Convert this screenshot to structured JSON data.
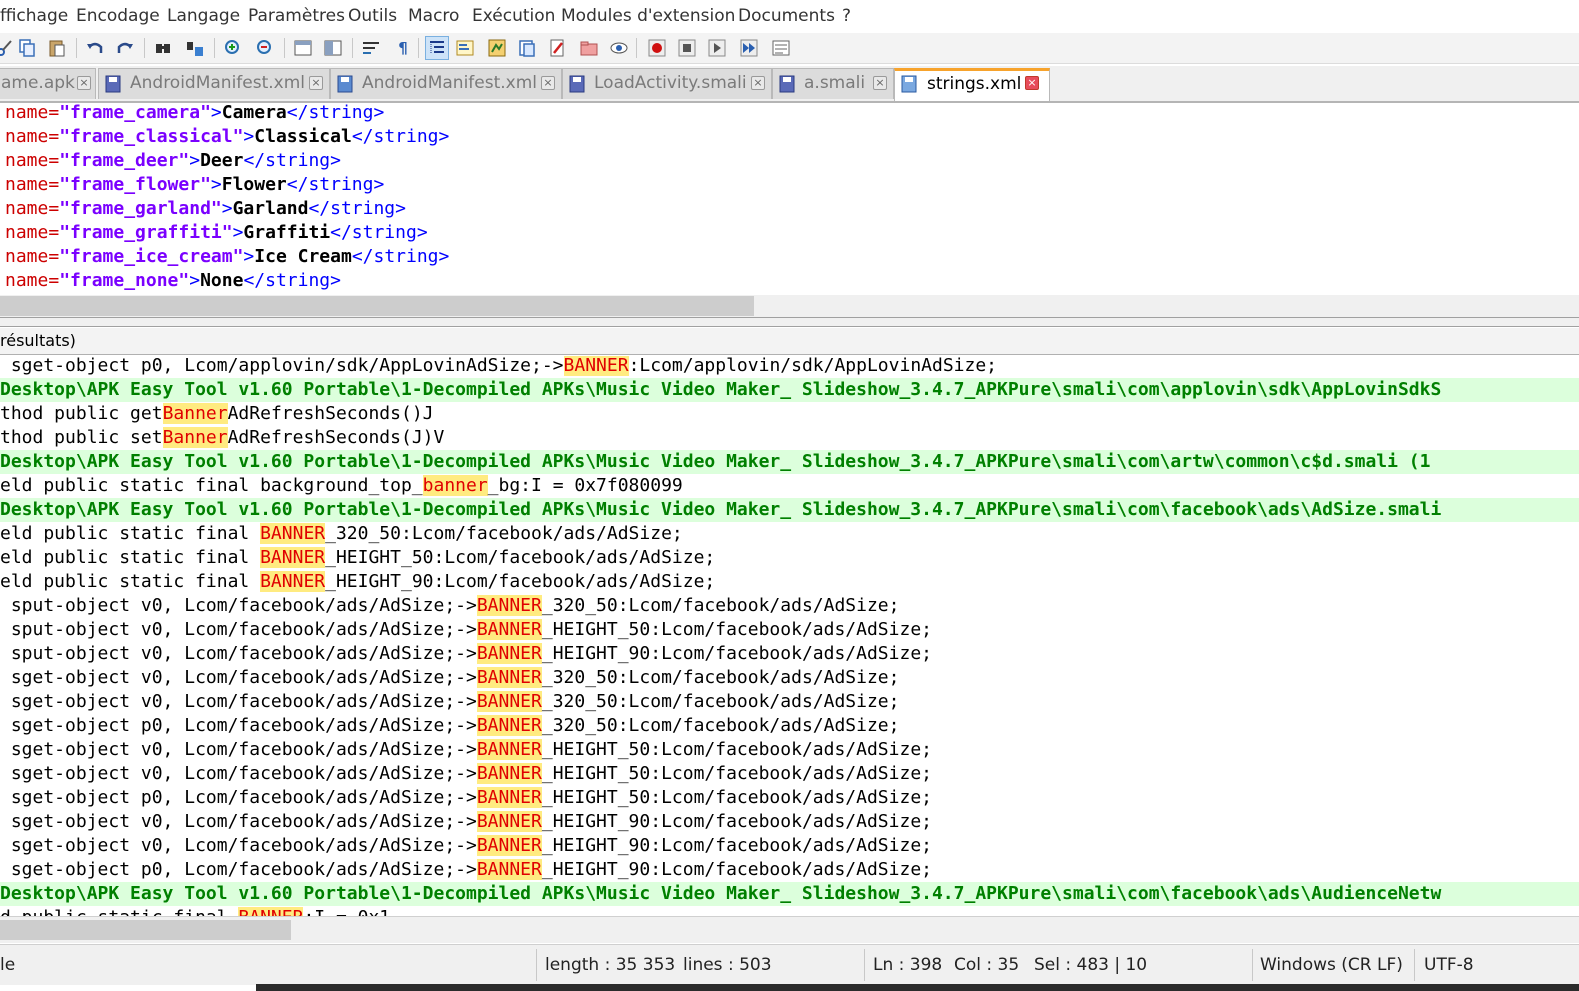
{
  "menu": [
    "ffichage",
    "Encodage",
    "Langage",
    "Paramètres",
    "Outils",
    "Macro",
    "Exécution",
    "Modules d'extension",
    "Documents",
    "?"
  ],
  "toolbar_icons": [
    "cut-icon",
    "copy-icon",
    "paste-icon",
    "undo-icon",
    "redo-icon",
    "find-icon",
    "replace-icon",
    "zoom-in-icon",
    "zoom-out-icon",
    "sync-vertical-icon",
    "sync-horizontal-icon",
    "word-wrap-icon",
    "show-all-chars-icon",
    "indent-guide-icon",
    "function-list-icon",
    "document-map-icon",
    "folder-workspace-icon",
    "monitoring-icon",
    "record-macro-icon",
    "stop-record-icon",
    "play-macro-icon",
    "run-macro-multiple-icon",
    "save-macro-icon"
  ],
  "tabs": [
    {
      "label": "ame.apk",
      "active": false
    },
    {
      "label": "AndroidManifest.xml",
      "active": false
    },
    {
      "label": "AndroidManifest.xml",
      "active": false
    },
    {
      "label": "LoadActivity.smali",
      "active": false
    },
    {
      "label": "a.smali",
      "active": false
    },
    {
      "label": "strings.xml",
      "active": true
    }
  ],
  "editor_lines": [
    {
      "attr": "name=",
      "val": "\"frame_camera\"",
      "text": "Camera"
    },
    {
      "attr": "name=",
      "val": "\"frame_classical\"",
      "text": "Classical"
    },
    {
      "attr": "name=",
      "val": "\"frame_deer\"",
      "text": "Deer"
    },
    {
      "attr": "name=",
      "val": "\"frame_flower\"",
      "text": "Flower"
    },
    {
      "attr": "name=",
      "val": "\"frame_garland\"",
      "text": "Garland"
    },
    {
      "attr": "name=",
      "val": "\"frame_graffiti\"",
      "text": "Graffiti"
    },
    {
      "attr": "name=",
      "val": "\"frame_ice_cream\"",
      "text": "Ice Cream"
    },
    {
      "attr": "name=",
      "val": "\"frame_none\"",
      "text": "None"
    }
  ],
  "results_title": "résultats)",
  "results_lines": [
    {
      "type": "line",
      "parts": [
        " sget-object p0, Lcom/applovin/sdk/AppLovinAdSize;->",
        {
          "hl": "BANNER"
        },
        ":Lcom/applovin/sdk/AppLovinAdSize;"
      ]
    },
    {
      "type": "file",
      "parts": [
        "Desktop\\APK Easy Tool v1.60 Portable\\1-Decompiled APKs\\Music Video Maker_ Slideshow_3.4.7_APKPure\\smali\\com\\applovin\\sdk\\AppLovinSdkS"
      ]
    },
    {
      "type": "line",
      "parts": [
        "thod public get",
        {
          "hl": "Banner"
        },
        "AdRefreshSeconds()J"
      ]
    },
    {
      "type": "line",
      "parts": [
        "thod public set",
        {
          "hl": "Banner"
        },
        "AdRefreshSeconds(J)V"
      ]
    },
    {
      "type": "file",
      "parts": [
        "Desktop\\APK Easy Tool v1.60 Portable\\1-Decompiled APKs\\Music Video Maker_ Slideshow_3.4.7_APKPure\\smali\\com\\artw\\common\\c$d.smali (1"
      ]
    },
    {
      "type": "line",
      "parts": [
        "eld public static final background_top_",
        {
          "hl": "banner"
        },
        "_bg:I = 0x7f080099"
      ]
    },
    {
      "type": "file",
      "parts": [
        "Desktop\\APK Easy Tool v1.60 Portable\\1-Decompiled APKs\\Music Video Maker_ Slideshow_3.4.7_APKPure\\smali\\com\\facebook\\ads\\AdSize.smali"
      ]
    },
    {
      "type": "line",
      "parts": [
        "eld public static final ",
        {
          "hl": "BANNER"
        },
        "_320_50:Lcom/facebook/ads/AdSize;"
      ]
    },
    {
      "type": "line",
      "parts": [
        "eld public static final ",
        {
          "hl": "BANNER"
        },
        "_HEIGHT_50:Lcom/facebook/ads/AdSize;"
      ]
    },
    {
      "type": "line",
      "parts": [
        "eld public static final ",
        {
          "hl": "BANNER"
        },
        "_HEIGHT_90:Lcom/facebook/ads/AdSize;"
      ]
    },
    {
      "type": "line",
      "parts": [
        " sput-object v0, Lcom/facebook/ads/AdSize;->",
        {
          "hl": "BANNER"
        },
        "_320_50:Lcom/facebook/ads/AdSize;"
      ]
    },
    {
      "type": "line",
      "parts": [
        " sput-object v0, Lcom/facebook/ads/AdSize;->",
        {
          "hl": "BANNER"
        },
        "_HEIGHT_50:Lcom/facebook/ads/AdSize;"
      ]
    },
    {
      "type": "line",
      "parts": [
        " sput-object v0, Lcom/facebook/ads/AdSize;->",
        {
          "hl": "BANNER"
        },
        "_HEIGHT_90:Lcom/facebook/ads/AdSize;"
      ]
    },
    {
      "type": "line",
      "parts": [
        " sget-object v0, Lcom/facebook/ads/AdSize;->",
        {
          "hl": "BANNER"
        },
        "_320_50:Lcom/facebook/ads/AdSize;"
      ]
    },
    {
      "type": "line",
      "parts": [
        " sget-object v0, Lcom/facebook/ads/AdSize;->",
        {
          "hl": "BANNER"
        },
        "_320_50:Lcom/facebook/ads/AdSize;"
      ]
    },
    {
      "type": "line",
      "parts": [
        " sget-object p0, Lcom/facebook/ads/AdSize;->",
        {
          "hl": "BANNER"
        },
        "_320_50:Lcom/facebook/ads/AdSize;"
      ]
    },
    {
      "type": "line",
      "parts": [
        " sget-object v0, Lcom/facebook/ads/AdSize;->",
        {
          "hl": "BANNER"
        },
        "_HEIGHT_50:Lcom/facebook/ads/AdSize;"
      ]
    },
    {
      "type": "line",
      "parts": [
        " sget-object v0, Lcom/facebook/ads/AdSize;->",
        {
          "hl": "BANNER"
        },
        "_HEIGHT_50:Lcom/facebook/ads/AdSize;"
      ]
    },
    {
      "type": "line",
      "parts": [
        " sget-object p0, Lcom/facebook/ads/AdSize;->",
        {
          "hl": "BANNER"
        },
        "_HEIGHT_50:Lcom/facebook/ads/AdSize;"
      ]
    },
    {
      "type": "line",
      "parts": [
        " sget-object v0, Lcom/facebook/ads/AdSize;->",
        {
          "hl": "BANNER"
        },
        "_HEIGHT_90:Lcom/facebook/ads/AdSize;"
      ]
    },
    {
      "type": "line",
      "parts": [
        " sget-object v0, Lcom/facebook/ads/AdSize;->",
        {
          "hl": "BANNER"
        },
        "_HEIGHT_90:Lcom/facebook/ads/AdSize;"
      ]
    },
    {
      "type": "line",
      "parts": [
        " sget-object p0, Lcom/facebook/ads/AdSize;->",
        {
          "hl": "BANNER"
        },
        "_HEIGHT_90:Lcom/facebook/ads/AdSize;"
      ]
    },
    {
      "type": "file",
      "parts": [
        "Desktop\\APK Easy Tool v1.60 Portable\\1-Decompiled APKs\\Music Video Maker_ Slideshow_3.4.7_APKPure\\smali\\com\\facebook\\ads\\AudienceNetw"
      ]
    },
    {
      "type": "line",
      "parts": [
        "d public static final ",
        {
          "hl": "BANNER"
        },
        ":I = 0x1"
      ]
    }
  ],
  "status": {
    "left": "le",
    "length": "length : 35 353",
    "lines": "lines : 503",
    "ln": "Ln : 398",
    "col": "Col : 35",
    "sel": "Sel : 483 | 10",
    "eol": "Windows (CR LF)",
    "encoding": "UTF-8"
  },
  "colors": {
    "tag": "#0000ff",
    "attr": "#cc0000",
    "value": "#7a00ff",
    "file_line_bg": "#dcffdc",
    "file_line_fg": "#008000",
    "match_bg": "#ffeb80",
    "match_fg": "#e00000",
    "active_tab_accent": "#f7a32c",
    "close_active": "#e74c5b"
  }
}
